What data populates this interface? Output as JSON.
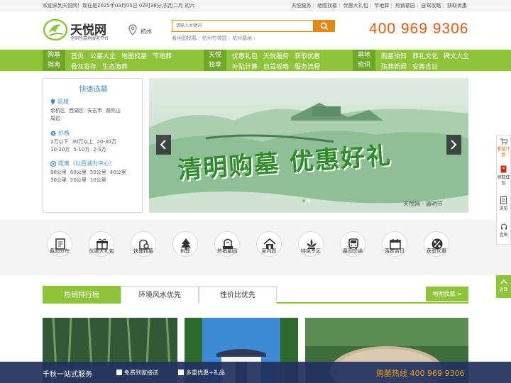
{
  "topbar": {
    "welcome": "欢迎来到天悦网！现在是2025年03月05日 02时38分,农历二月 初六",
    "links": [
      "天悦服务",
      "地图找墓",
      "优惠大礼包",
      "节地葬",
      "热销墓园",
      "自驾攻略",
      "获取优惠"
    ]
  },
  "header": {
    "brand": "天悦网",
    "slogan": "全国性墓地服务平台",
    "city": "杭州",
    "search_placeholder": "请输入关键词",
    "hot_links": [
      "看地图找墓",
      "杭州竹茶园",
      "杭州墓地"
    ],
    "phone": "400 969 9306"
  },
  "nav": {
    "groups": [
      {
        "tag": [
          "购墓",
          "指南"
        ],
        "items": [
          "首页",
          "公墓大全",
          "地图找墓",
          "节地葬",
          "骨灰寄存",
          "生态海葬"
        ]
      },
      {
        "tag": [
          "天悦",
          "独享"
        ],
        "items": [
          "优惠礼包",
          "天悦服务",
          "获取优惠",
          "补贴计算",
          "自驾攻略",
          "服务流程"
        ]
      },
      {
        "tag": [
          "墓地",
          "资讯"
        ],
        "items": [
          "购墓须知",
          "葬礼文化",
          "碑文大全",
          "殡葬新闻",
          "安葬吉日"
        ]
      }
    ]
  },
  "quick_select": {
    "title": "快速选墓",
    "region": {
      "head": "区域",
      "options": [
        "余杭区",
        "西湖区",
        "安吉市",
        "普陀山",
        "周边"
      ]
    },
    "price": {
      "head": "价格",
      "options": [
        "2万以下",
        "30万以上",
        "20-30万",
        "10-20万",
        "5-10万",
        "2-5万"
      ]
    },
    "distance": {
      "head": "距离（以西湖为中心）",
      "options": [
        "80公里",
        "60公里",
        "50公里",
        "40公里",
        "30公里",
        "20公里",
        "10公里"
      ]
    }
  },
  "banner": {
    "headline": "清明购墓 优惠好礼",
    "signature": "天悦网 · 清明节"
  },
  "quick_icons": [
    {
      "label": "墓园分布",
      "icon": "map-doc-icon"
    },
    {
      "label": "优惠大礼包",
      "icon": "gift-icon"
    },
    {
      "label": "快速找墓",
      "icon": "search-grave-icon"
    },
    {
      "label": "树葬",
      "icon": "tree-icon"
    },
    {
      "label": "热销墓园",
      "icon": "hot-grave-icon"
    },
    {
      "label": "室内葬",
      "icon": "house-icon"
    },
    {
      "label": "特色专区",
      "icon": "lotus-icon"
    },
    {
      "label": "墓园交通",
      "icon": "bus-icon"
    },
    {
      "label": "落葬吉日",
      "icon": "calendar-icon"
    },
    {
      "label": "获取优惠",
      "icon": "percent-icon"
    }
  ],
  "tabs": [
    "热销排行榜",
    "环境风水优先",
    "性价比优先"
  ],
  "map_button": "地图找墓 >",
  "bottom_bar": {
    "title": "千秋一站式服务",
    "checks": [
      "免费到家接送",
      "多重优惠+礼品"
    ],
    "hotline": "购墓热线 400 969 9306"
  },
  "side_float": [
    "看墓计划",
    "领取红包",
    "浏览",
    "咨询"
  ],
  "back_top": "返回"
}
